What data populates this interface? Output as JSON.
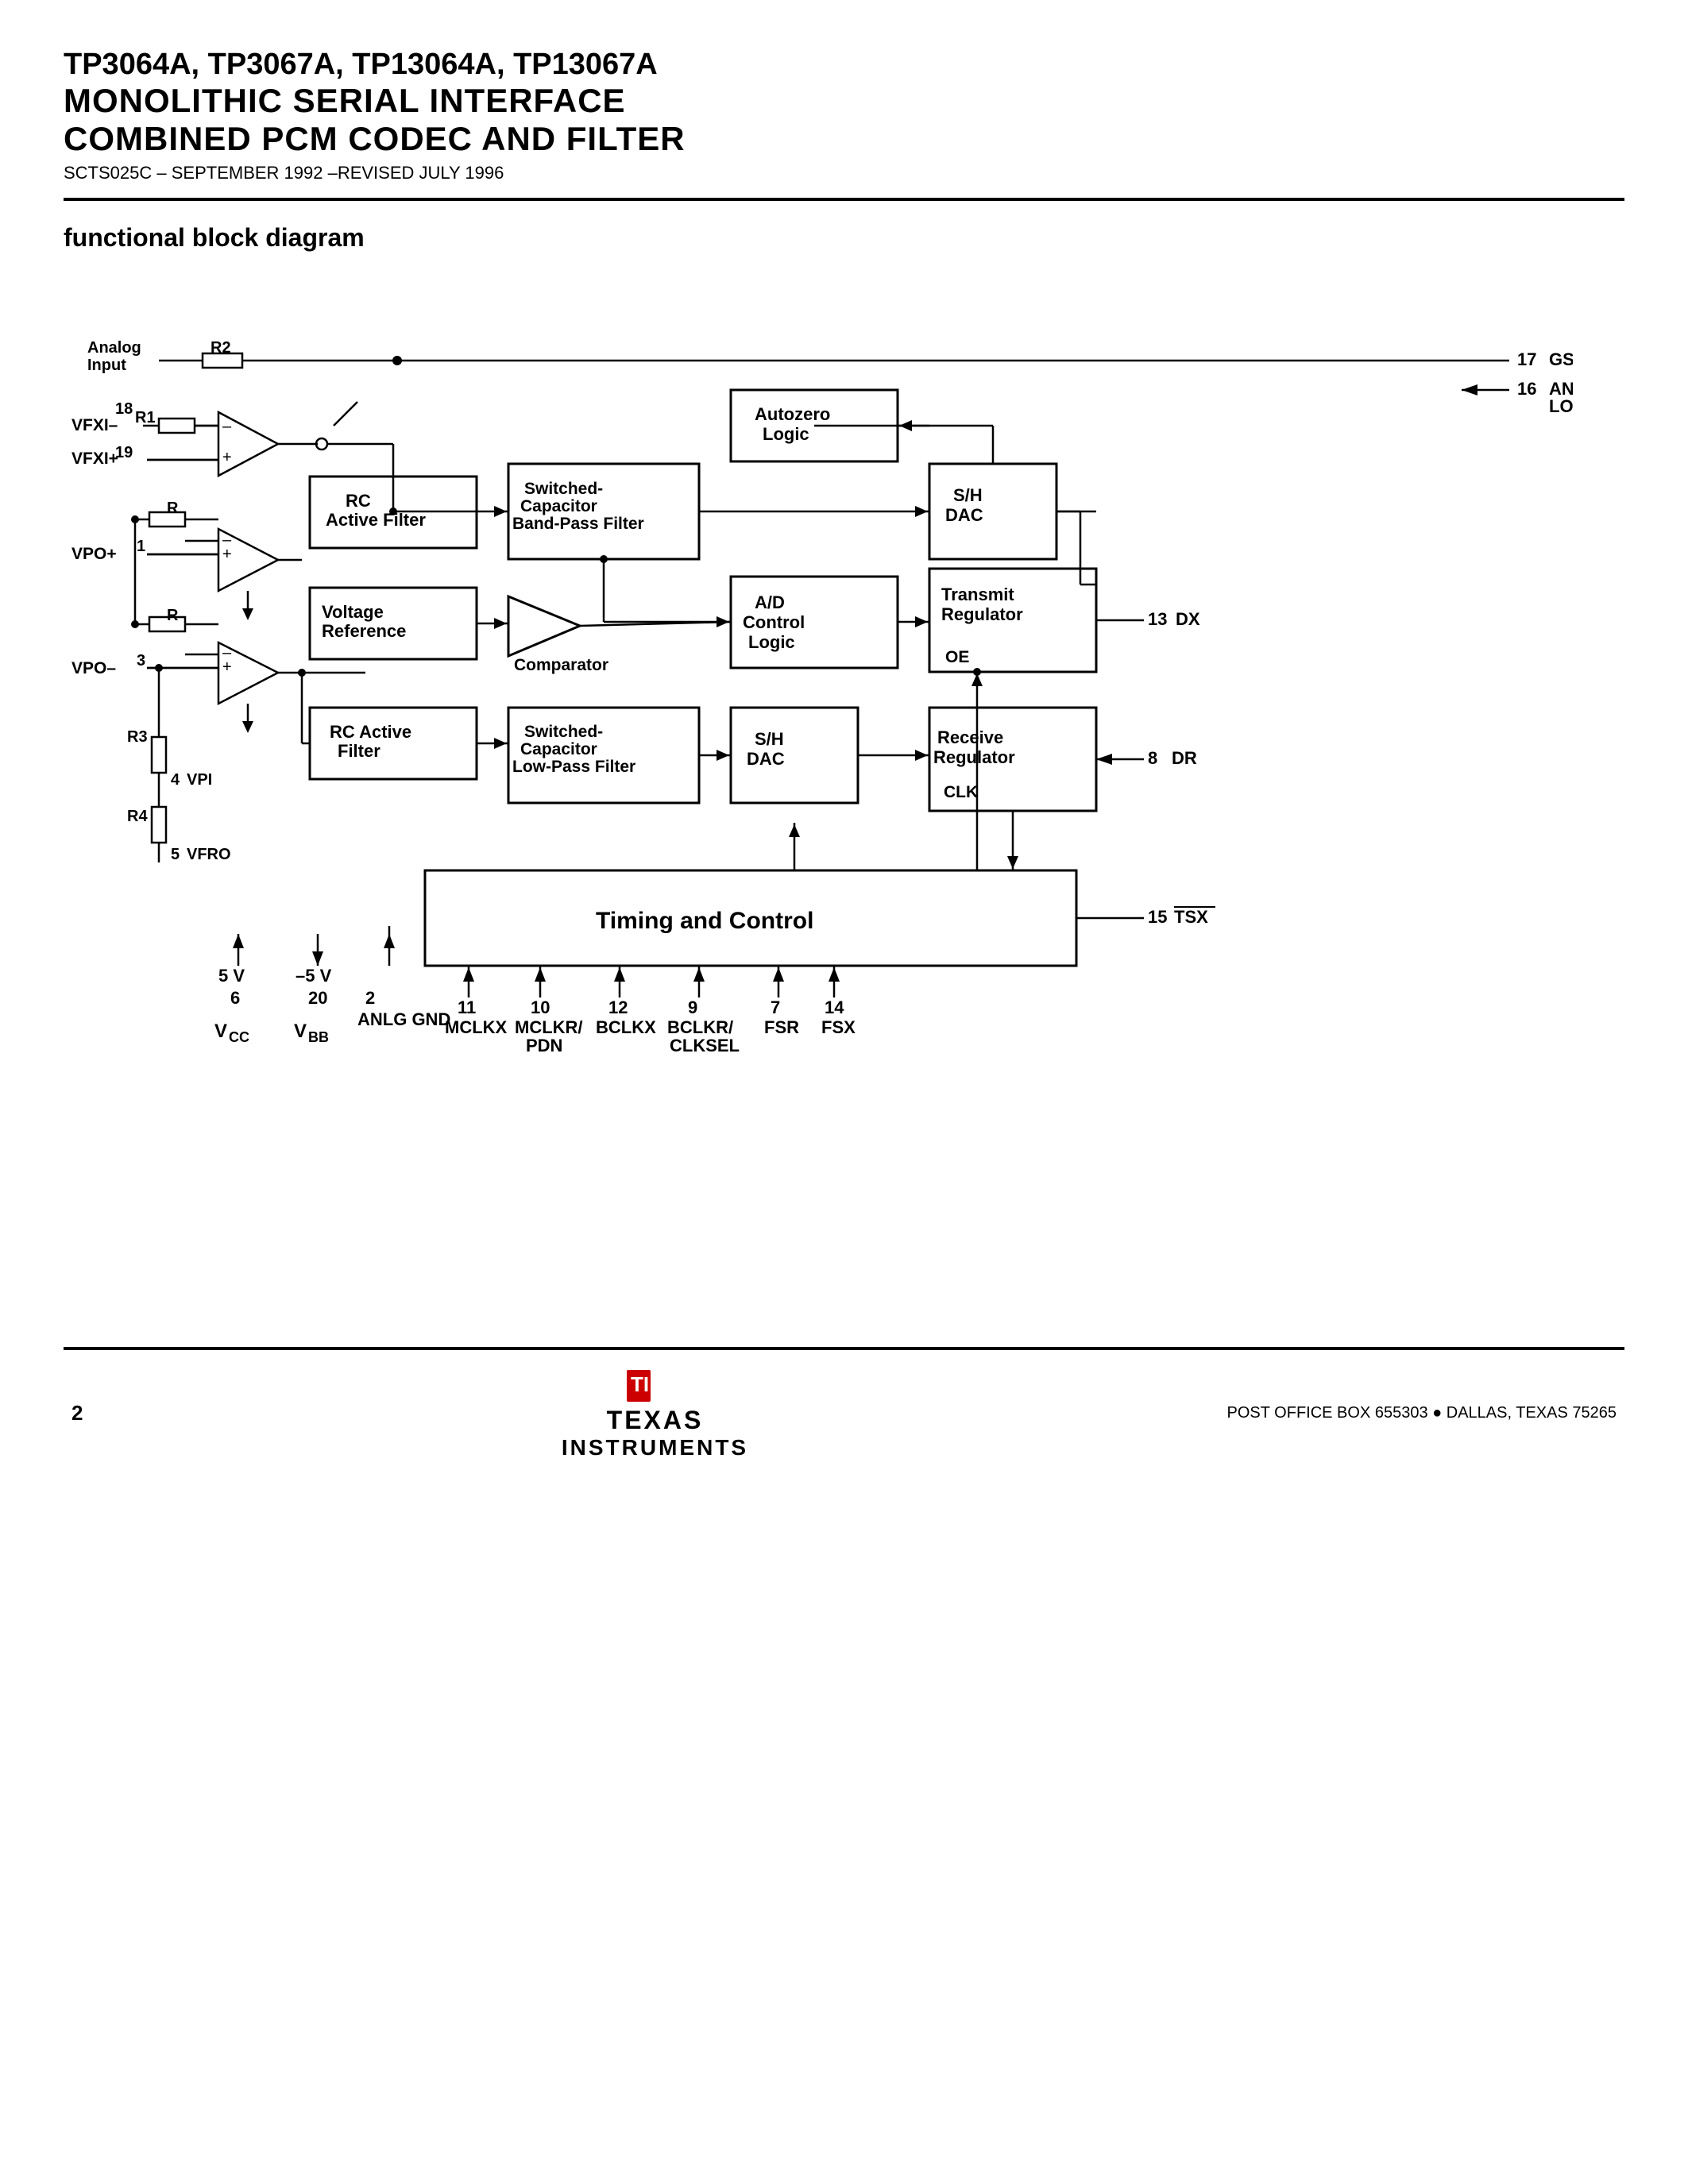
{
  "header": {
    "title_line1": "TP3064A, TP3067A, TP13064A, TP13067A",
    "title_line2": "MONOLITHIC SERIAL INTERFACE",
    "title_line3": "COMBINED PCM CODEC AND FILTER",
    "subtitle": "SCTS025C – SEPTEMBER 1992 –REVISED JULY 1996"
  },
  "section": {
    "title": "functional block diagram"
  },
  "timing_control_label": "Timing and Control",
  "footer": {
    "page_number": "2",
    "company_line1": "TEXAS",
    "company_line2": "INSTRUMENTS",
    "address": "POST OFFICE BOX 655303  ●  DALLAS, TEXAS 75265"
  }
}
